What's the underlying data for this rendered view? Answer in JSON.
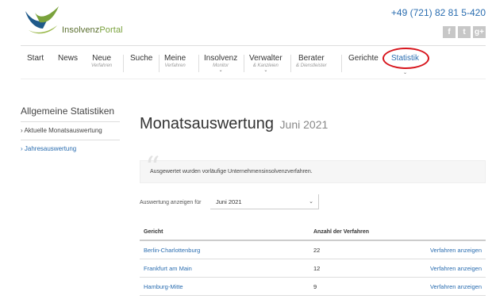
{
  "header": {
    "logo_text_a": "Insolvenz",
    "logo_text_b": "Portal",
    "phone": "+49 (721) 82 81 5-420",
    "social": [
      "f",
      "t",
      "g+"
    ]
  },
  "nav": [
    {
      "label": "Start",
      "sub": "",
      "chev": ""
    },
    {
      "label": "News",
      "sub": "",
      "chev": ""
    },
    {
      "label": "Neue",
      "sub": "Verfahren",
      "chev": ""
    },
    {
      "label": "Suche",
      "sub": "",
      "chev": ""
    },
    {
      "label": "Meine",
      "sub": "Verfahren",
      "chev": ""
    },
    {
      "label": "Insolvenz",
      "sub": "Monitor",
      "chev": "⌄"
    },
    {
      "label": "Verwalter",
      "sub": "& Kanzleien",
      "chev": "⌄"
    },
    {
      "label": "Berater",
      "sub": "& Dienstleister",
      "chev": ""
    },
    {
      "label": "Gerichte",
      "sub": "",
      "chev": ""
    },
    {
      "label": "Statistik",
      "sub": "",
      "chev": "⌄"
    }
  ],
  "sidebar": {
    "title": "Allgemeine Statistiken",
    "items": [
      "› Aktuelle Monatsauswertung",
      "› Jahresauswertung"
    ]
  },
  "main": {
    "title": "Monatsauswertung",
    "subtitle": "Juni 2021",
    "info": "Ausgewertet wurden vorläufige Unternehmensinsolvenzverfahren.",
    "filter_label": "Auswertung anzeigen für",
    "filter_value": "Juni 2021",
    "table": {
      "headers": [
        "Gericht",
        "Anzahl der Verfahren"
      ],
      "rows": [
        {
          "court": "Berlin-Charlottenburg",
          "count": "22",
          "action": "Verfahren anzeigen"
        },
        {
          "court": "Frankfurt am Main",
          "count": "12",
          "action": "Verfahren anzeigen"
        },
        {
          "court": "Hamburg-Mitte",
          "count": "9",
          "action": "Verfahren anzeigen"
        }
      ]
    }
  },
  "colors": {
    "accent": "#2a6db0",
    "highlight": "#d7141c",
    "brand_green": "#7aa23c"
  }
}
